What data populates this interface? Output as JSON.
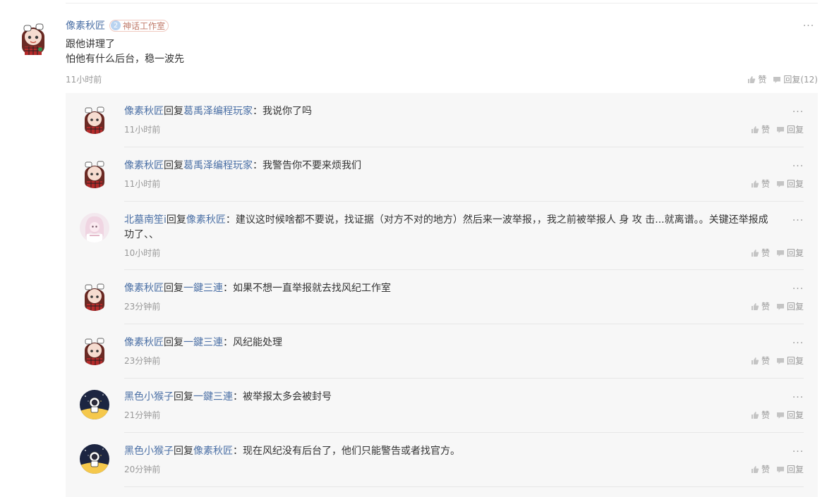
{
  "main": {
    "author": "像素秋匠",
    "badge_level": "2",
    "badge_label": "神话工作室",
    "more": "···",
    "lines": [
      "跟他讲理了",
      "怕他有什么后台，稳一波先"
    ],
    "time": "11小时前",
    "like_label": "赞",
    "reply_label": "回复(12)"
  },
  "replies": [
    {
      "user": "像素秋匠",
      "reply_word": "回复",
      "target": "葛禹泽编程玩家",
      "sep": "：",
      "text": "我说你了吗",
      "text2": "",
      "time": "11小时前",
      "like_label": "赞",
      "reply_label": "回复",
      "more": "···",
      "avatar": "anime-girl"
    },
    {
      "user": "像素秋匠",
      "reply_word": "回复",
      "target": "葛禹泽编程玩家",
      "sep": "：",
      "text": "我警告你不要来烦我们",
      "text2": "",
      "time": "11小时前",
      "like_label": "赞",
      "reply_label": "回复",
      "more": "···",
      "avatar": "anime-girl"
    },
    {
      "user": "北墓南笙i",
      "reply_word": "回复",
      "target": "像素秋匠",
      "sep": "：",
      "text": "建议这时候啥都不要说，找证据（对方不对的地方）然后来一波举报，，我之前被举报人 身 攻 击...就离谱。。关键还举报成",
      "text2": "功了、、",
      "time": "10小时前",
      "like_label": "赞",
      "reply_label": "回复",
      "more": "···",
      "avatar": "pink-girl"
    },
    {
      "user": "像素秋匠",
      "reply_word": "回复",
      "target": "一鍵三連",
      "sep": "：",
      "text": "如果不想一直举报就去找风纪工作室",
      "text2": "",
      "time": "23分钟前",
      "like_label": "赞",
      "reply_label": "回复",
      "more": "···",
      "avatar": "anime-girl"
    },
    {
      "user": "像素秋匠",
      "reply_word": "回复",
      "target": "一鍵三連",
      "sep": "：",
      "text": "风纪能处理",
      "text2": "",
      "time": "23分钟前",
      "like_label": "赞",
      "reply_label": "回复",
      "more": "···",
      "avatar": "anime-girl"
    },
    {
      "user": "黑色小猴子",
      "reply_word": "回复",
      "target": "一鍵三連",
      "sep": "：",
      "text": "被举报太多会被封号",
      "text2": "",
      "time": "21分钟前",
      "like_label": "赞",
      "reply_label": "回复",
      "more": "···",
      "avatar": "astronaut"
    },
    {
      "user": "黑色小猴子",
      "reply_word": "回复",
      "target": "像素秋匠",
      "sep": "：",
      "text": "现在风纪没有后台了，他们只能警告或者找官方。",
      "text2": "",
      "time": "20分钟前",
      "like_label": "赞",
      "reply_label": "回复",
      "more": "···",
      "avatar": "astronaut"
    }
  ],
  "colors": {
    "link": "#4a6fa5",
    "muted": "#999999",
    "reply_bg": "#f7f7f7"
  }
}
